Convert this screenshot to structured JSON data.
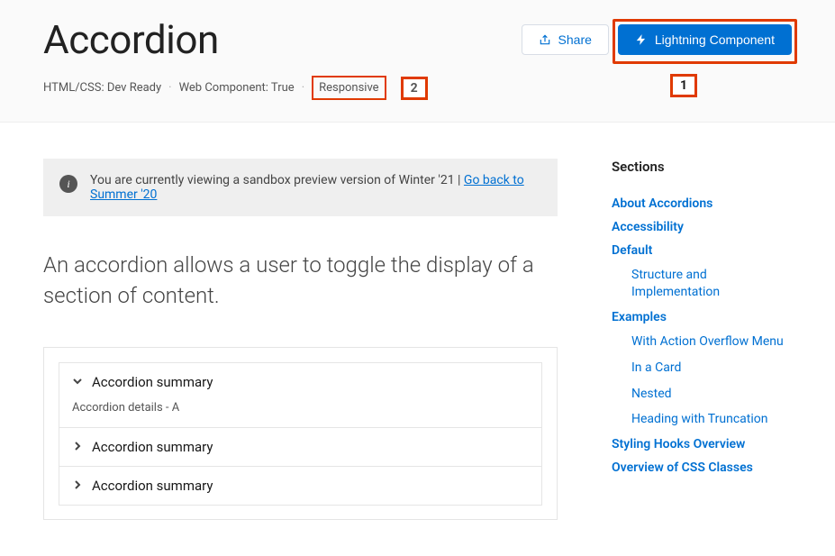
{
  "header": {
    "title": "Accordion",
    "share_label": "Share",
    "lightning_label": "Lightning Component",
    "badges": {
      "html_css": "HTML/CSS: Dev Ready",
      "web_component": "Web Component: True",
      "responsive": "Responsive"
    },
    "annotation_1": "1",
    "annotation_2": "2"
  },
  "notice": {
    "text_before": "You are currently viewing a sandbox preview version of Winter '21 | ",
    "link": "Go back to Summer '20"
  },
  "intro": "An accordion allows a user to toggle the display of a section of content.",
  "accordion": {
    "items": [
      {
        "summary": "Accordion summary",
        "details": "Accordion details - A",
        "open": true
      },
      {
        "summary": "Accordion summary",
        "details": "",
        "open": false
      },
      {
        "summary": "Accordion summary",
        "details": "",
        "open": false
      }
    ]
  },
  "toc": {
    "heading": "Sections",
    "items": [
      {
        "label": "About Accordions",
        "sub": false
      },
      {
        "label": "Accessibility",
        "sub": false
      },
      {
        "label": "Default",
        "sub": false
      },
      {
        "label": "Structure and Implementation",
        "sub": true
      },
      {
        "label": "Examples",
        "sub": false
      },
      {
        "label": "With Action Overflow Menu",
        "sub": true
      },
      {
        "label": "In a Card",
        "sub": true
      },
      {
        "label": "Nested",
        "sub": true
      },
      {
        "label": "Heading with Truncation",
        "sub": true
      },
      {
        "label": "Styling Hooks Overview",
        "sub": false
      },
      {
        "label": "Overview of CSS Classes",
        "sub": false
      }
    ]
  }
}
